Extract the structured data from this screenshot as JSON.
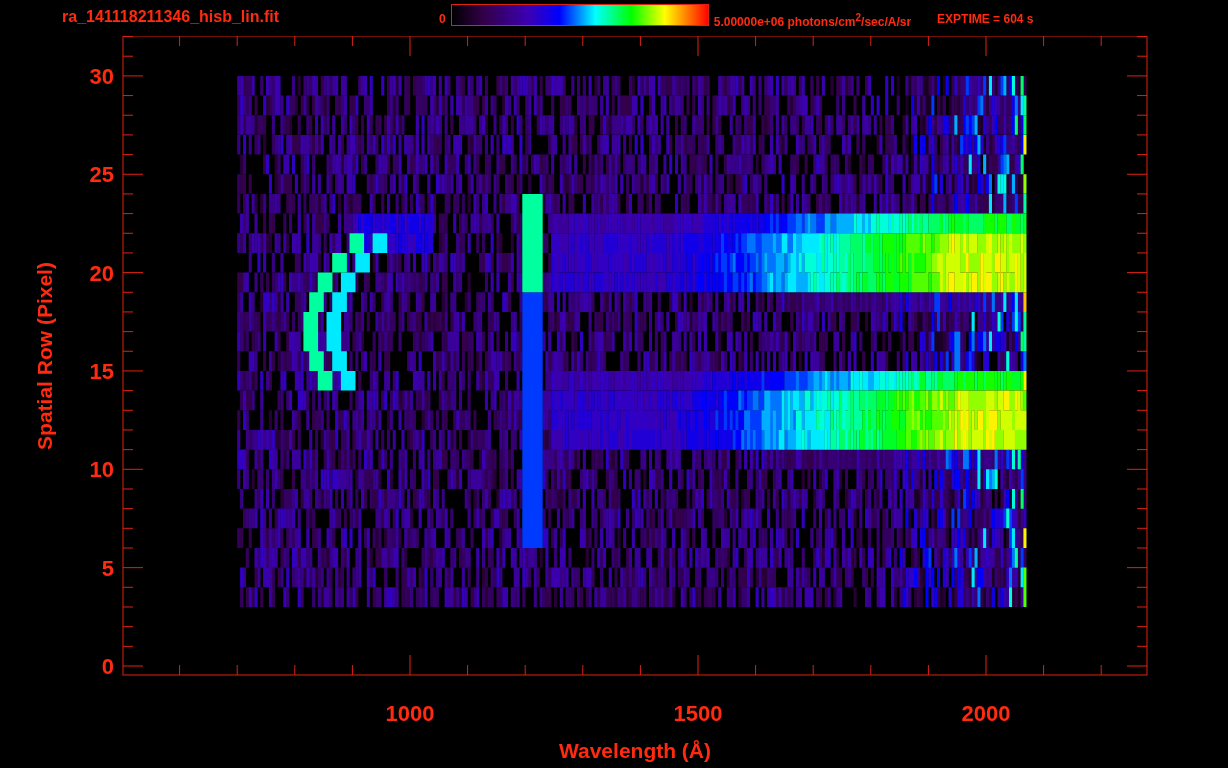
{
  "header": {
    "filename": "ra_141118211346_hisb_lin.fit",
    "colorbar_min": "0",
    "colorbar_max": "5.00000e+06 photons/cm$^{2}$/sec/A/sr",
    "exposure": "EXPTIME = 604 s"
  },
  "plot": {
    "xlabel": "Wavelength (Å)",
    "ylabel": "Spatial Row (Pixel)",
    "xticks": [
      "1000",
      "1500",
      "2000"
    ],
    "yticks": [
      "30",
      "25",
      "20",
      "15",
      "10",
      "5",
      "0"
    ]
  }
}
